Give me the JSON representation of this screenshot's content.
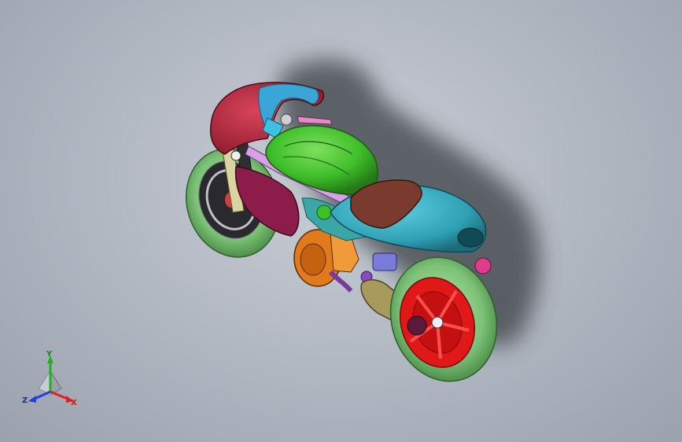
{
  "viewport": {
    "background_top": "#c9ced6",
    "background_bottom": "#9aa2ae"
  },
  "model": {
    "colors": {
      "fairing_red": "#b3243a",
      "fairing_blue": "#3aa6d8",
      "tank_green": "#3fbf2a",
      "tail_teal": "#2f9fb4",
      "seat_brown": "#7a3b2e",
      "tire_green": "#8ed08a",
      "rear_rim_red": "#e01818",
      "engine_orange": "#e07a1a",
      "frame_maroon": "#8c1d4a",
      "swingarm_khaki": "#a89a5a",
      "shadow": "#3b3f45"
    }
  },
  "triad": {
    "y_label": "Y",
    "x_label": "X",
    "z_label": "Z",
    "colors": {
      "x": "#e02020",
      "y": "#20b020",
      "z": "#2040e0"
    }
  }
}
